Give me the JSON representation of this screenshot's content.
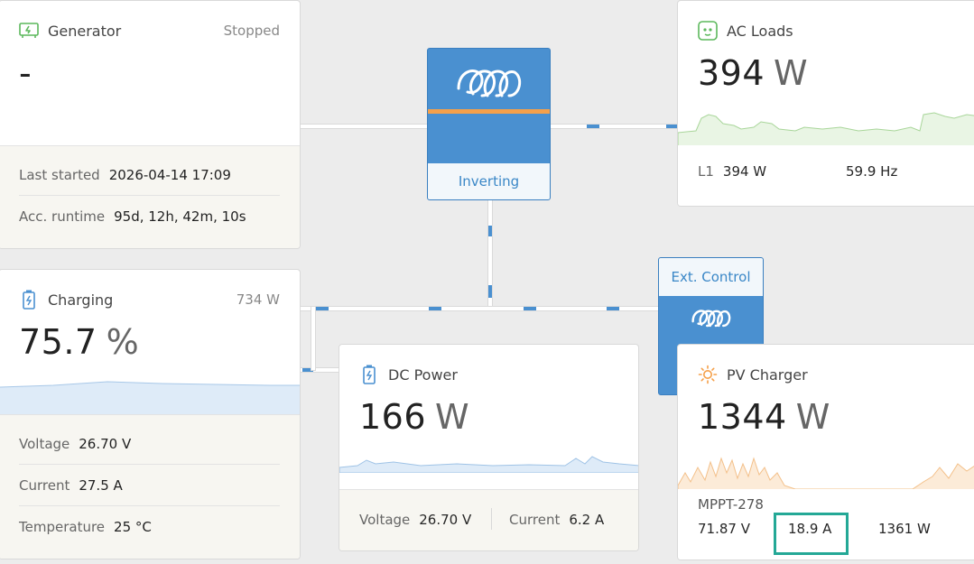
{
  "generator": {
    "title": "Generator",
    "status": "Stopped",
    "value": "-",
    "last_started_label": "Last started",
    "last_started_value": "2026-04-14 17:09",
    "runtime_label": "Acc. runtime",
    "runtime_value": "95d, 12h, 42m, 10s"
  },
  "inverter": {
    "state": "Inverting"
  },
  "ac_loads": {
    "title": "AC Loads",
    "value": "394",
    "unit": "W",
    "l1_label": "L1",
    "l1_power": "394 W",
    "frequency": "59.9 Hz"
  },
  "ext_control": {
    "label": "Ext. Control"
  },
  "battery": {
    "title": "Charging",
    "power": "734 W",
    "value": "75.7",
    "unit": "%",
    "voltage_label": "Voltage",
    "voltage_value": "26.70 V",
    "current_label": "Current",
    "current_value": "27.5 A",
    "temperature_label": "Temperature",
    "temperature_value": "25 °C"
  },
  "dc_power": {
    "title": "DC Power",
    "value": "166",
    "unit": "W",
    "voltage_label": "Voltage",
    "voltage_value": "26.70 V",
    "current_label": "Current",
    "current_value": "6.2 A"
  },
  "pv_charger": {
    "title": "PV Charger",
    "value": "1344",
    "unit": "W",
    "device_name": "MPPT-278",
    "voltage_value": "71.87 V",
    "current_value": "18.9 A",
    "power_value": "1361 W"
  },
  "colors": {
    "accent_blue": "#4a90d0",
    "generator_green": "#5cb85c",
    "pv_orange": "#f5a04a",
    "highlight_teal": "#24a896"
  },
  "icons": [
    "generator-icon",
    "victron-logo",
    "ac-socket-icon",
    "battery-icon",
    "battery-icon",
    "sun-icon"
  ]
}
